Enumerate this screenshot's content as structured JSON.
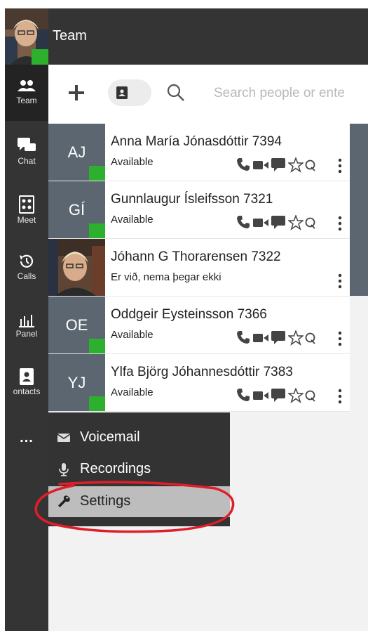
{
  "header": {
    "title": "Team"
  },
  "rail": {
    "items": [
      {
        "label": "Team",
        "icon": "people-icon"
      },
      {
        "label": "Chat",
        "icon": "chat-icon"
      },
      {
        "label": "Meet",
        "icon": "meet-icon"
      },
      {
        "label": "Calls",
        "icon": "history-icon"
      },
      {
        "label": "Panel",
        "icon": "bar-chart-icon"
      },
      {
        "label": "ontacts",
        "icon": "contact-card-icon"
      }
    ],
    "more_label": "..."
  },
  "toolbar": {
    "search_placeholder": "Search people or ente"
  },
  "contacts": [
    {
      "initials": "AJ",
      "name": "Anna María Jónasdóttir 7394",
      "status": "Available",
      "presence": "online"
    },
    {
      "initials": "GÍ",
      "name": "Gunnlaugur Ísleifsson 7321",
      "status": "Available",
      "presence": "online"
    },
    {
      "initials": "",
      "name": "Jóhann G Thorarensen 7322",
      "status": "Er við, nema þegar ekki",
      "presence": "photo"
    },
    {
      "initials": "OE",
      "name": "Oddgeir Eysteinsson 7366",
      "status": "Available",
      "presence": "online"
    },
    {
      "initials": "YJ",
      "name": "Ylfa Björg Jóhannesdóttir 7383",
      "status": "Available",
      "presence": "online"
    }
  ],
  "menu": {
    "items": [
      {
        "label": "Voicemail",
        "icon": "envelope-icon"
      },
      {
        "label": "Recordings",
        "icon": "microphone-icon"
      },
      {
        "label": "Settings",
        "icon": "wrench-icon"
      }
    ]
  },
  "colors": {
    "rail_bg": "#343434",
    "presence_green": "#2db02d",
    "avatar_bg": "#5b6670",
    "annotation_red": "#e01e2a"
  }
}
